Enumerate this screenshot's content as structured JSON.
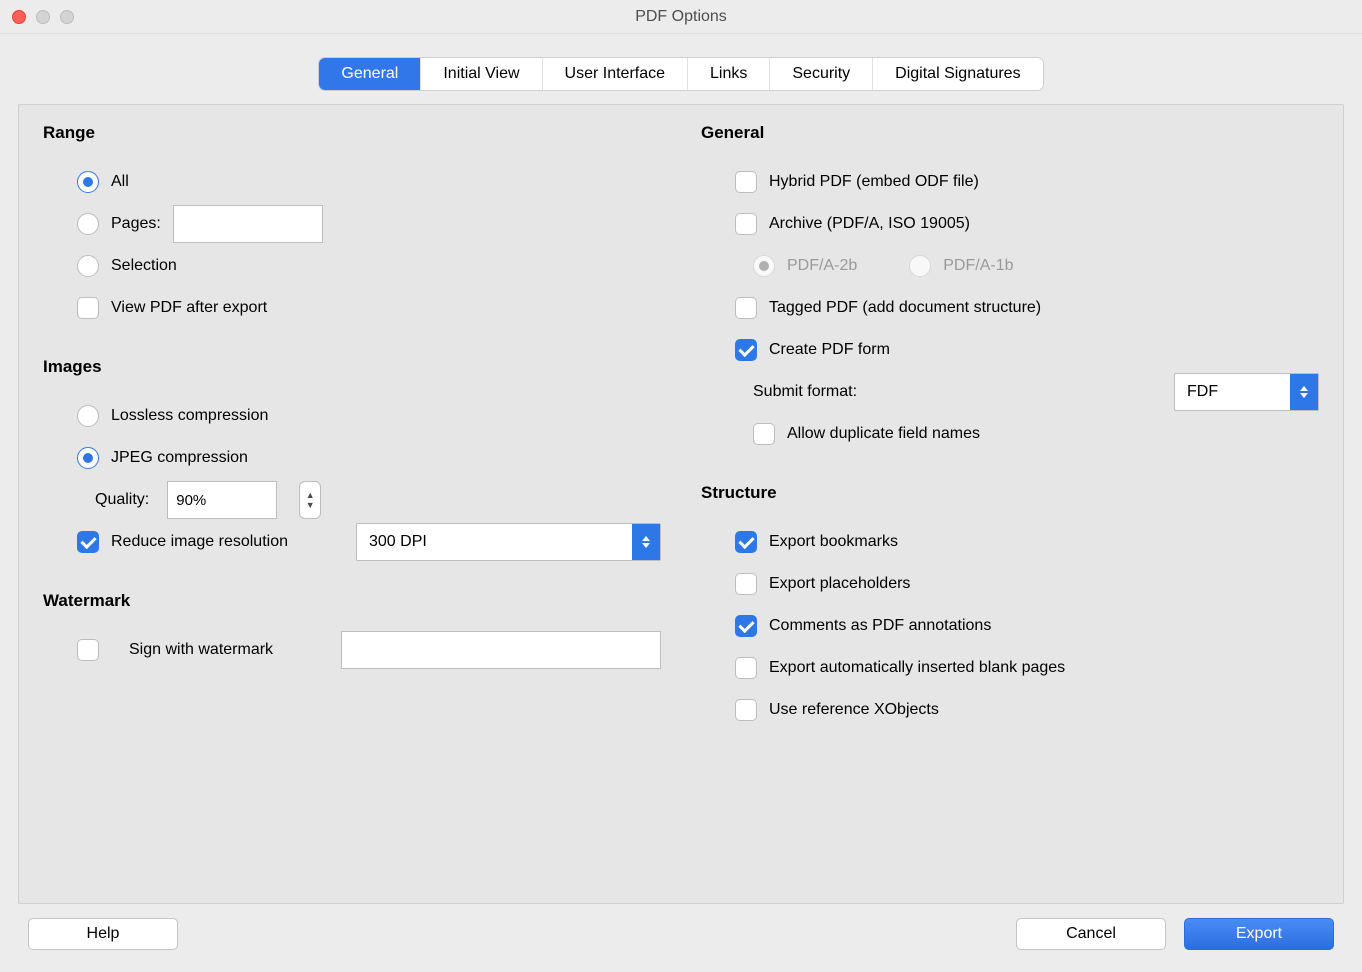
{
  "title": "PDF Options",
  "tabs": [
    "General",
    "Initial View",
    "User Interface",
    "Links",
    "Security",
    "Digital Signatures"
  ],
  "range": {
    "title": "Range",
    "all": "All",
    "pages": "Pages:",
    "pages_value": "",
    "selection": "Selection",
    "view_after": "View PDF after export"
  },
  "images": {
    "title": "Images",
    "lossless": "Lossless compression",
    "jpeg": "JPEG compression",
    "quality_label": "Quality:",
    "quality_value": "90%",
    "reduce": "Reduce image resolution",
    "dpi_value": "300 DPI"
  },
  "watermark": {
    "title": "Watermark",
    "sign": "Sign with watermark",
    "text_value": ""
  },
  "general": {
    "title": "General",
    "hybrid": "Hybrid PDF (embed ODF file)",
    "archive": "Archive (PDF/A, ISO 19005)",
    "pdfa2b": "PDF/A-2b",
    "pdfa1b": "PDF/A-1b",
    "tagged": "Tagged PDF (add document structure)",
    "form": "Create PDF form",
    "submit_label": "Submit format:",
    "submit_value": "FDF",
    "dup_names": "Allow duplicate field names"
  },
  "structure": {
    "title": "Structure",
    "bookmarks": "Export bookmarks",
    "placeholders": "Export placeholders",
    "comments": "Comments as PDF annotations",
    "blank_pages": "Export automatically inserted blank pages",
    "xobjects": "Use reference XObjects"
  },
  "buttons": {
    "help": "Help",
    "cancel": "Cancel",
    "export": "Export"
  }
}
